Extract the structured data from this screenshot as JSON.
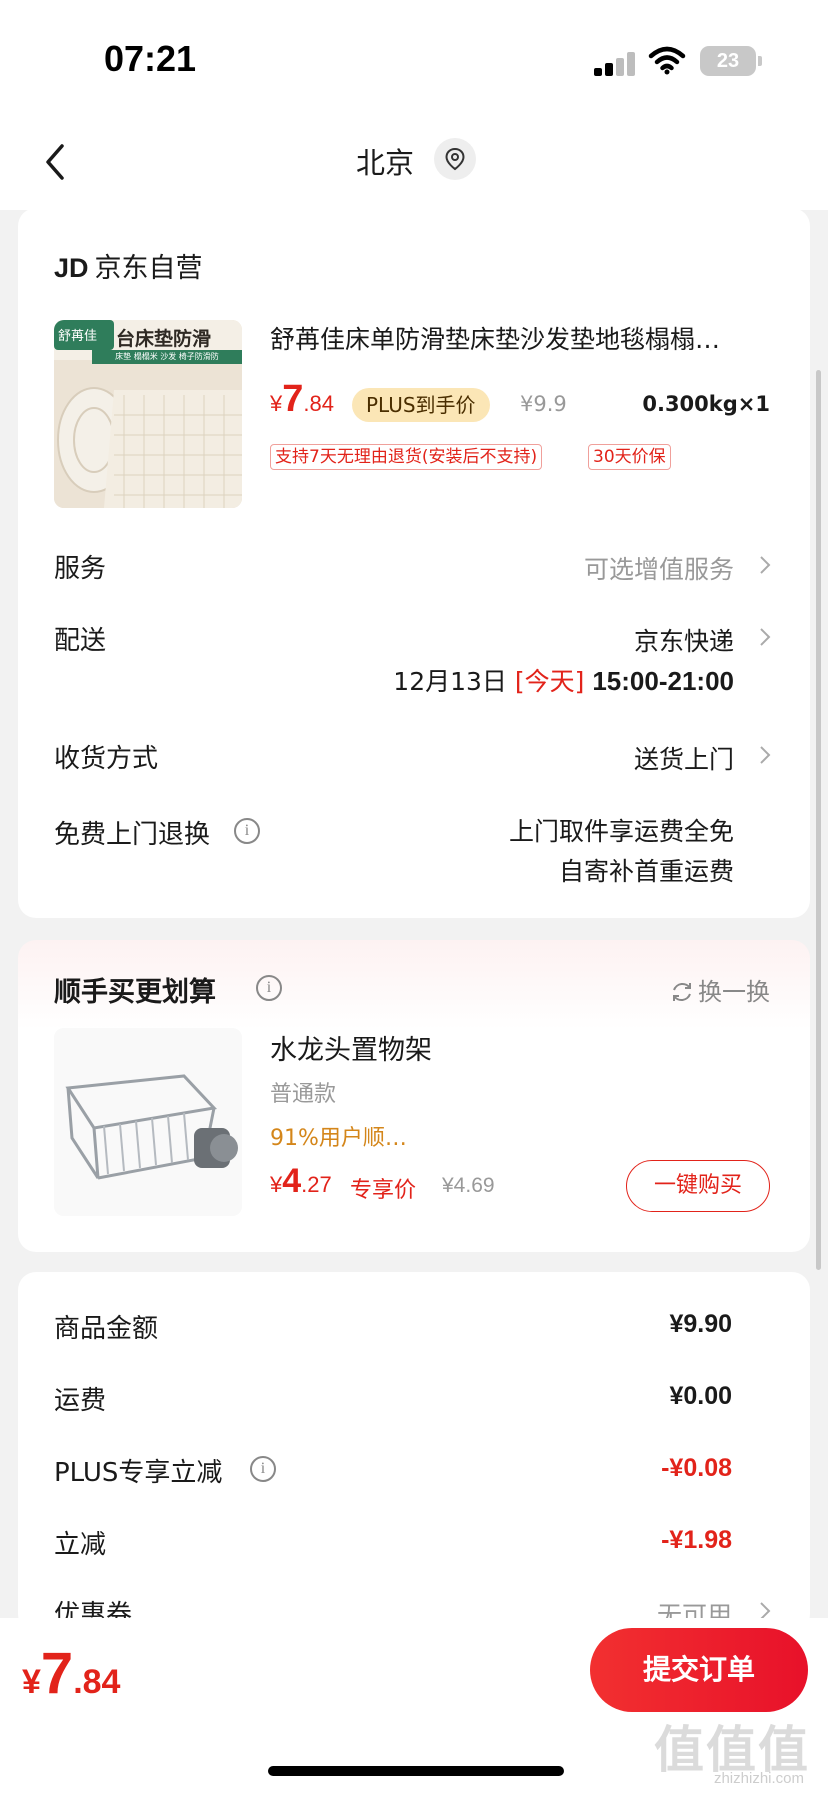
{
  "status_bar": {
    "time": "07:21",
    "battery": "23"
  },
  "navbar": {
    "title": "北京"
  },
  "order_item": {
    "shop_prefix": "JD",
    "shop_name": "京东自营",
    "image_brand": "舒苒佳",
    "image_caption": "台床垫防滑",
    "image_sub": "床垫 榻榻米 沙发 椅子防滑防",
    "title": "舒苒佳床单防滑垫床垫沙发垫地毯榻榻…",
    "price_symbol": "¥",
    "price_int": "7",
    "price_dec": ".84",
    "plus_badge": "PLUS到手价",
    "original_price": "¥9.9",
    "weight_qty": "0.300kg×1",
    "tags": [
      "支持7天无理由退货(安装后不支持)",
      "30天价保"
    ]
  },
  "service": {
    "label": "服务",
    "value": "可选增值服务"
  },
  "delivery": {
    "label": "配送",
    "carrier": "京东快递",
    "date": "12月13日",
    "today": "[今天]",
    "time_window": "15:00-21:00"
  },
  "receive": {
    "label": "收货方式",
    "value": "送货上门"
  },
  "free_return": {
    "label": "免费上门退换",
    "line1": "上门取件享运费全免",
    "line2": "自寄补首重运费"
  },
  "addon": {
    "title": "顺手买更划算",
    "swap_label": "换一换",
    "name": "水龙头置物架",
    "spec": "普通款",
    "hot": "91%用户顺…",
    "price_symbol": "¥",
    "price_int": "4",
    "price_dec": ".27",
    "exclusive": "专享价",
    "original_price": "¥4.69",
    "buy_label": "一键购买"
  },
  "summary": {
    "rows": [
      {
        "label": "商品金额",
        "value": "¥9.90"
      },
      {
        "label": "运费",
        "value": "¥0.00"
      },
      {
        "label": "PLUS专享立减",
        "value": "-¥0.08"
      },
      {
        "label": "立减",
        "value": "-¥1.98"
      },
      {
        "label": "优惠券",
        "value": "无可用"
      }
    ]
  },
  "bottom": {
    "total_symbol": "¥",
    "total_int": "7",
    "total_dec": ".84",
    "submit_label": "提交订单"
  },
  "watermark": {
    "main": "值值值",
    "sub": "zhizhizhi.com"
  },
  "colors": {
    "accent_red": "#e2231a",
    "plus_gold": "#fbe6b6",
    "hot_orange": "#d4861a"
  }
}
